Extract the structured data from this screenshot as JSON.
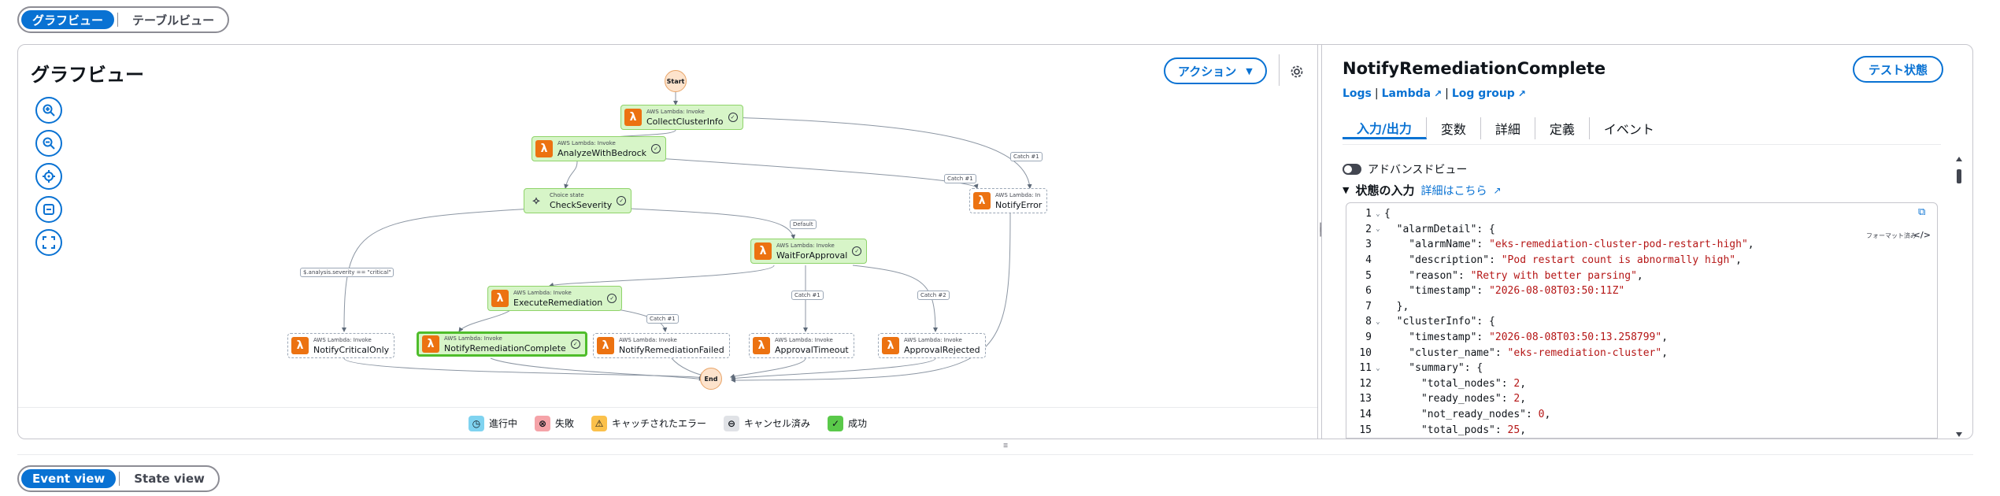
{
  "view_toggle": {
    "graph": "グラフビュー",
    "table": "テーブルビュー"
  },
  "graph": {
    "title": "グラフビュー",
    "action_label": "アクション",
    "nodes": {
      "start": "Start",
      "end": "End",
      "collect": {
        "type": "AWS Lambda: Invoke",
        "name": "CollectClusterInfo"
      },
      "analyze": {
        "type": "AWS Lambda: Invoke",
        "name": "AnalyzeWithBedrock"
      },
      "check": {
        "type": "Choice state",
        "name": "CheckSeverity"
      },
      "notify_error": {
        "type": "AWS Lambda: In",
        "name": "NotifyError"
      },
      "wait": {
        "type": "AWS Lambda: Invoke",
        "name": "WaitForApproval"
      },
      "execute": {
        "type": "AWS Lambda: Invoke",
        "name": "ExecuteRemediation"
      },
      "critical": {
        "type": "AWS Lambda: Invoke",
        "name": "NotifyCriticalOnly"
      },
      "complete": {
        "type": "AWS Lambda: Invoke",
        "name": "NotifyRemediationComplete"
      },
      "failed": {
        "type": "AWS Lambda: Invoke",
        "name": "NotifyRemediationFailed"
      },
      "timeout": {
        "type": "AWS Lambda: Invoke",
        "name": "ApprovalTimeout"
      },
      "rejected": {
        "type": "AWS Lambda: Invoke",
        "name": "ApprovalRejected"
      }
    },
    "edge_labels": {
      "catch1_a": "Catch #1",
      "catch1_b": "Catch #1",
      "default": "Default",
      "critical_cond": "$.analysis.severity == \"critical\"",
      "catch1_c": "Catch #1",
      "catch1_d": "Catch #1",
      "catch2": "Catch #2"
    },
    "legend": [
      {
        "label": "進行中",
        "icon": "clock-icon",
        "color": "#7fd3f0"
      },
      {
        "label": "失敗",
        "icon": "x-icon",
        "color": "#f5a3a8"
      },
      {
        "label": "キャッチされたエラー",
        "icon": "warning-icon",
        "color": "#fbc14b"
      },
      {
        "label": "キャンセル済み",
        "icon": "minus-icon",
        "color": "#e0e2e6"
      },
      {
        "label": "成功",
        "icon": "check-icon",
        "color": "#5ac94a"
      }
    ]
  },
  "panel": {
    "title": "NotifyRemediationComplete",
    "test_button": "テスト状態",
    "links": {
      "logs": "Logs",
      "lambda": "Lambda",
      "log_group": "Log group"
    },
    "tabs": [
      "入力/出力",
      "変数",
      "詳細",
      "定義",
      "イベント"
    ],
    "advanced_view": "アドバンスドビュー",
    "input_header": "状態の入力",
    "more_info": "詳細はこちら",
    "format_label": "フォーマット済み",
    "code_lines": [
      {
        "n": "1",
        "fold": true,
        "indent": "",
        "key": "",
        "val": "",
        "text": "{"
      },
      {
        "n": "2",
        "fold": true,
        "indent": "  ",
        "key": "\"alarmDetail\"",
        "val": "",
        "text": ": {"
      },
      {
        "n": "3",
        "fold": false,
        "indent": "    ",
        "key": "\"alarmName\"",
        "val": "\"eks-remediation-cluster-pod-restart-high\"",
        "text": ","
      },
      {
        "n": "4",
        "fold": false,
        "indent": "    ",
        "key": "\"description\"",
        "val": "\"Pod restart count is abnormally high\"",
        "text": ","
      },
      {
        "n": "5",
        "fold": false,
        "indent": "    ",
        "key": "\"reason\"",
        "val": "\"Retry with better parsing\"",
        "text": ","
      },
      {
        "n": "6",
        "fold": false,
        "indent": "    ",
        "key": "\"timestamp\"",
        "val": "\"2026-08-08T03:50:11Z\"",
        "text": ""
      },
      {
        "n": "7",
        "fold": false,
        "indent": "  ",
        "key": "",
        "val": "",
        "text": "},"
      },
      {
        "n": "8",
        "fold": true,
        "indent": "  ",
        "key": "\"clusterInfo\"",
        "val": "",
        "text": ": {"
      },
      {
        "n": "9",
        "fold": false,
        "indent": "    ",
        "key": "\"timestamp\"",
        "val": "\"2026-08-08T03:50:13.258799\"",
        "text": ","
      },
      {
        "n": "10",
        "fold": false,
        "indent": "    ",
        "key": "\"cluster_name\"",
        "val": "\"eks-remediation-cluster\"",
        "text": ","
      },
      {
        "n": "11",
        "fold": true,
        "indent": "    ",
        "key": "\"summary\"",
        "val": "",
        "text": ": {"
      },
      {
        "n": "12",
        "fold": false,
        "indent": "      ",
        "key": "\"total_nodes\"",
        "val": "2",
        "text": ","
      },
      {
        "n": "13",
        "fold": false,
        "indent": "      ",
        "key": "\"ready_nodes\"",
        "val": "2",
        "text": ","
      },
      {
        "n": "14",
        "fold": false,
        "indent": "      ",
        "key": "\"not_ready_nodes\"",
        "val": "0",
        "text": ","
      },
      {
        "n": "15",
        "fold": false,
        "indent": "      ",
        "key": "\"total_pods\"",
        "val": "25",
        "text": ","
      }
    ]
  },
  "bottom_toggle": {
    "event": "Event view",
    "state": "State view"
  }
}
